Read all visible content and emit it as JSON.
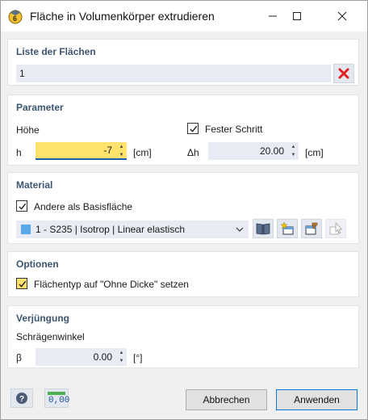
{
  "window": {
    "title": "Fläche in Volumenkörper extrudieren",
    "minimize": "—",
    "maximize": "☐",
    "close": "✕"
  },
  "surfaces": {
    "section_title": "Liste der Flächen",
    "value": "1"
  },
  "parameters": {
    "section_title": "Parameter",
    "height_label": "Höhe",
    "h_label": "h",
    "h_value": "-7",
    "h_unit": "[cm]",
    "fixed_step_label": "Fester Schritt",
    "fixed_step_checked": true,
    "dh_label": "Δh",
    "dh_value": "20.00",
    "dh_unit": "[cm]"
  },
  "material": {
    "section_title": "Material",
    "other_than_base_label": "Andere als Basisfläche",
    "other_than_base_checked": true,
    "selected": "1 - S235 | Isotrop | Linear elastisch",
    "swatch_color": "#5aa8e8"
  },
  "options": {
    "section_title": "Optionen",
    "surface_type_label": "Flächentyp auf \"Ohne Dicke\" setzen",
    "surface_type_checked": true
  },
  "taper": {
    "section_title": "Verjüngung",
    "angle_label": "Schrägenwinkel",
    "beta_label": "β",
    "beta_value": "0.00",
    "beta_unit": "[°]"
  },
  "footer": {
    "cancel_label": "Abbrechen",
    "apply_label": "Anwenden",
    "units_badge": "0,00"
  },
  "colors": {
    "accent_yellow": "#ffe26b",
    "section_title": "#3c5570",
    "delete_red": "#e02020",
    "field_bg": "#e8ebf3"
  }
}
